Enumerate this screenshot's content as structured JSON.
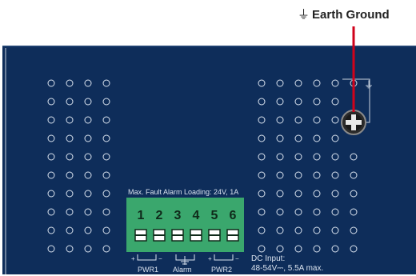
{
  "callout": {
    "ground_symbol": "⏚",
    "label": "Earth Ground",
    "leader_color": "#d0021b"
  },
  "panel": {
    "background_color": "#0e2d5a",
    "border_color": "#c9d3df",
    "text_color": "#d9e2ee"
  },
  "terminal_block": {
    "caption": "Max. Fault Alarm Loading: 24V, 1A",
    "color": "#3aa76d",
    "pins": [
      "1",
      "2",
      "3",
      "4",
      "5",
      "6"
    ],
    "groups": [
      {
        "name": "PWR1",
        "polarity": [
          "+",
          "−"
        ]
      },
      {
        "name": "Alarm",
        "polarity": [
          "",
          ""
        ]
      },
      {
        "name": "PWR2",
        "polarity": [
          "+",
          "−"
        ]
      }
    ]
  },
  "dc_input": {
    "line1": "DC Input:",
    "line2": "48-54V⎓, 5.5A max."
  },
  "ground_screw": {
    "panel_symbol": "⏚"
  }
}
